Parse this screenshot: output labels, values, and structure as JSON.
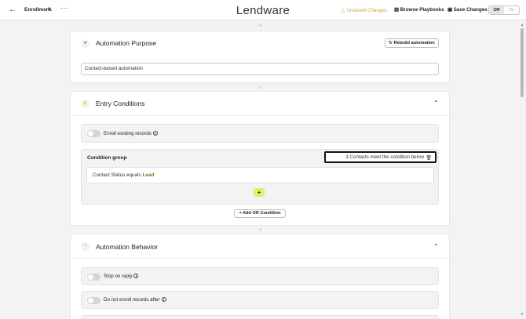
{
  "topbar": {
    "back_icon": "arrow-left-icon",
    "automation_name": "Enrollment",
    "edit_icon": "edit-icon",
    "more_label": "···",
    "logo": "Lendware",
    "unsaved_label": "Unsaved Changes",
    "unsaved_icon": "warning-triangle-icon",
    "browse_label": "Browse Playbooks",
    "browse_icon": "book-icon",
    "save_label": "Save Changes",
    "save_icon": "floppy-disk-icon",
    "toggle": {
      "off": "Off",
      "on": "On",
      "selected": "Off"
    }
  },
  "purpose": {
    "title": "Automation Purpose",
    "icon": "chat-bubble-icon",
    "rebuild_label": "Rebuild automation",
    "rebuild_icon": "refresh-icon",
    "input_value": "Contact-based automation"
  },
  "entry": {
    "title": "Entry Conditions",
    "icon": "lightning-icon",
    "enroll_existing_label": "Enroll existing records",
    "condition_group": {
      "title": "Condition group",
      "count_label": "3 Contacts meet the condition below",
      "rule_field": "Contact Status equals",
      "rule_value": "Lead",
      "add_label": "+"
    },
    "add_or_label": "+ Add OR Condition"
  },
  "behavior": {
    "title": "Automation Behavior",
    "icon": "gauge-icon",
    "stop_on_reply_label": "Stop on reply",
    "do_not_enroll_label": "Do not enroll records after"
  },
  "colors": {
    "accent_lime": "#d9f56b",
    "warning": "#d1a24a",
    "lead_green": "#5a8a1a"
  }
}
